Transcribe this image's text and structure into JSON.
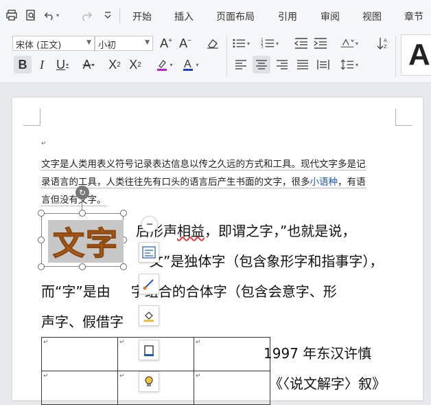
{
  "toolbar": {
    "quick_access": [
      "print-icon",
      "print-preview-icon",
      "undo-icon",
      "redo-icon",
      "customize-icon"
    ],
    "tabs": [
      "开始",
      "插入",
      "页面布局",
      "引用",
      "审阅",
      "视图",
      "章节"
    ]
  },
  "font": {
    "family_value": "宋体 (正文)",
    "size_value": "小初"
  },
  "style_preview": "A",
  "document": {
    "small_lines": [
      "文字是人类用表义符号记录表达信息以传之久远的方式和工具。现代文字多是记",
      "录语言的工具，人类往往先有口头的语言后产生书面的文字，很多",
      "言但没有文字。"
    ],
    "link_text": "小语种",
    "after_link": "，有语",
    "wordart_text": "文字",
    "big_lines": {
      "l1_pre": "后形声",
      "l1_wavy": "相益",
      "l1_post": "，即谓之字，”也就是说，",
      "l2": "文”是独体字（包含象形字和指事字），",
      "l3_pre": "而“字”是由",
      "l3_post": "字组合的合体字（包含会意字、形",
      "l4": "声字、假借字",
      "l5": "1997 年东汉许慎",
      "l6": "《〈说文解字〉叙》"
    },
    "para_mark": "↵"
  },
  "colors": {
    "accent_underline": "#c020c0",
    "font_color_bar": "#2040c0",
    "link": "#1f5aa8"
  }
}
